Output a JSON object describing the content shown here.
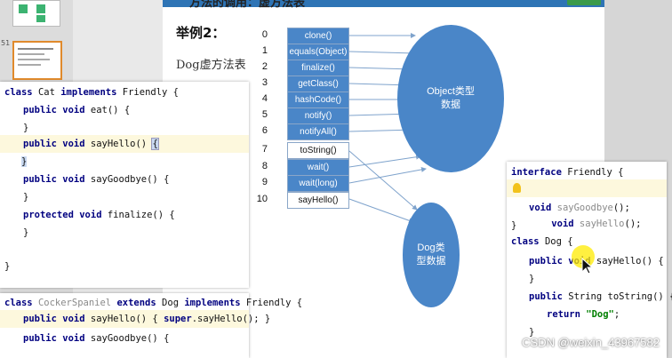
{
  "thumbs": {
    "slide_number": "51"
  },
  "slide": {
    "top_title": "方法的调用：虚方法表",
    "heading": "举例2：",
    "subtitle": "Dog虚方法表",
    "table": [
      {
        "index": "0",
        "method": "clone()",
        "style": "blue"
      },
      {
        "index": "1",
        "method": "equals(Object)",
        "style": "blue"
      },
      {
        "index": "2",
        "method": "finalize()",
        "style": "blue"
      },
      {
        "index": "3",
        "method": "getClass()",
        "style": "blue"
      },
      {
        "index": "4",
        "method": "hashCode()",
        "style": "blue"
      },
      {
        "index": "5",
        "method": "notify()",
        "style": "blue"
      },
      {
        "index": "6",
        "method": "notifyAll()",
        "style": "blue"
      },
      {
        "index": "7",
        "method": "toString()",
        "style": "white"
      },
      {
        "index": "8",
        "method": "wait()",
        "style": "blue"
      },
      {
        "index": "9",
        "method": "wait(long)",
        "style": "blue"
      },
      {
        "index": "10",
        "method": "sayHello()",
        "style": "white"
      }
    ],
    "object_ellipse": {
      "line1": "Object类型",
      "line2": "数据"
    },
    "dog_ellipse": {
      "line1": "Dog类",
      "line2": "型数据"
    }
  },
  "colors": {
    "box_blue": "#4a86c8",
    "keyword": "#000080",
    "string": "#008000",
    "highlight": "#fdf8dd"
  },
  "cat_code": {
    "l1": {
      "kw1": "class",
      "name": "Cat",
      "kw2": "implements",
      "rest": "Friendly {"
    },
    "l2": {
      "kw1": "public",
      "kw2": "void",
      "rest": "eat() {"
    },
    "l3": "}",
    "l4": {
      "kw1": "public",
      "kw2": "void",
      "rest": "sayHello() ",
      "brace": "{"
    },
    "l5": "}",
    "l6": {
      "kw1": "public",
      "kw2": "void",
      "rest": "sayGoodbye() {"
    },
    "l7": "}",
    "l8": {
      "kw1": "protected",
      "kw2": "void",
      "rest": "finalize() {"
    },
    "l9": "}",
    "l10": "}"
  },
  "cocker_code": {
    "l1": {
      "kw1": "class",
      "name": "CockerSpaniel",
      "kw2": "extends",
      "mid": "Dog",
      "kw3": "implements",
      "rest": "Friendly {"
    },
    "l2": {
      "kw1": "public",
      "kw2": "void",
      "rest": "sayHello() { ",
      "kw3": "super",
      "rest2": ".sayHello(); }"
    },
    "l3": {
      "kw1": "public",
      "kw2": "void",
      "rest": "sayGoodbye() {"
    }
  },
  "friendly_code": {
    "l1": {
      "kw1": "interface",
      "rest": "Friendly {"
    },
    "l2": {
      "kw1": "void",
      "name": "sayHello",
      "rest": "();"
    },
    "l3": {
      "kw1": "void",
      "name": "sayGoodbye",
      "rest": "();"
    },
    "l4": "}",
    "l5": {
      "kw1": "class",
      "rest": "Dog {"
    },
    "l6": {
      "kw1": "public",
      "kw2": "void",
      "rest": "sayHello() {"
    },
    "l7": "}",
    "l8": {
      "kw1": "public",
      "rest": "String toString() {"
    },
    "l9": {
      "kw1": "return",
      "str": "\"Dog\"",
      "rest": ";"
    },
    "l10": "}"
  },
  "watermark": "CSDN @weixin_43967582"
}
